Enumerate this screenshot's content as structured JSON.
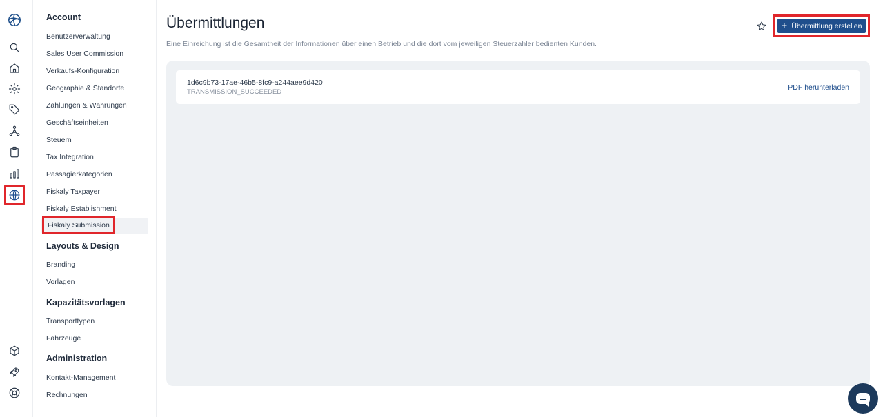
{
  "nav": {
    "sections": [
      {
        "title": "Account",
        "items": [
          "Benutzerverwaltung",
          "Sales User Commission",
          "Verkaufs-Konfiguration",
          "Geographie & Standorte",
          "Zahlungen & Währungen",
          "Geschäftseinheiten",
          "Steuern",
          "Tax Integration",
          "Passagierkategorien",
          "Fiskaly Taxpayer",
          "Fiskaly Establishment",
          "Fiskaly Submission"
        ]
      },
      {
        "title": "Layouts & Design",
        "items": [
          "Branding",
          "Vorlagen"
        ]
      },
      {
        "title": "Kapazitätsvorlagen",
        "items": [
          "Transporttypen",
          "Fahrzeuge"
        ]
      },
      {
        "title": "Administration",
        "items": [
          "Kontakt-Management",
          "Rechnungen"
        ]
      }
    ],
    "active_item": "Fiskaly Submission"
  },
  "rail": {
    "icons": [
      "logo-icon",
      "search-icon",
      "home-icon",
      "gear-icon",
      "tag-icon",
      "network-icon",
      "clipboard-icon",
      "bar-chart-icon",
      "globe-icon",
      "package-icon",
      "rocket-icon",
      "lifebuoy-icon"
    ],
    "active_icon": "globe-icon"
  },
  "header": {
    "title": "Übermittlungen",
    "description": "Eine Einreichung ist die Gesamtheit der Informationen über einen Betrieb und die dort vom jeweiligen Steuerzahler bedienten Kunden.",
    "create_button": "Übermittlung erstellen"
  },
  "submissions": [
    {
      "id": "1d6c9b73-17ae-46b5-8fc9-a244aee9d420",
      "status": "TRANSMISSION_SUCCEEDED",
      "action": "PDF herunterladen"
    }
  ],
  "colors": {
    "accent": "#1f4e8c",
    "highlight": "#e0262b",
    "panel": "#eef1f4"
  }
}
